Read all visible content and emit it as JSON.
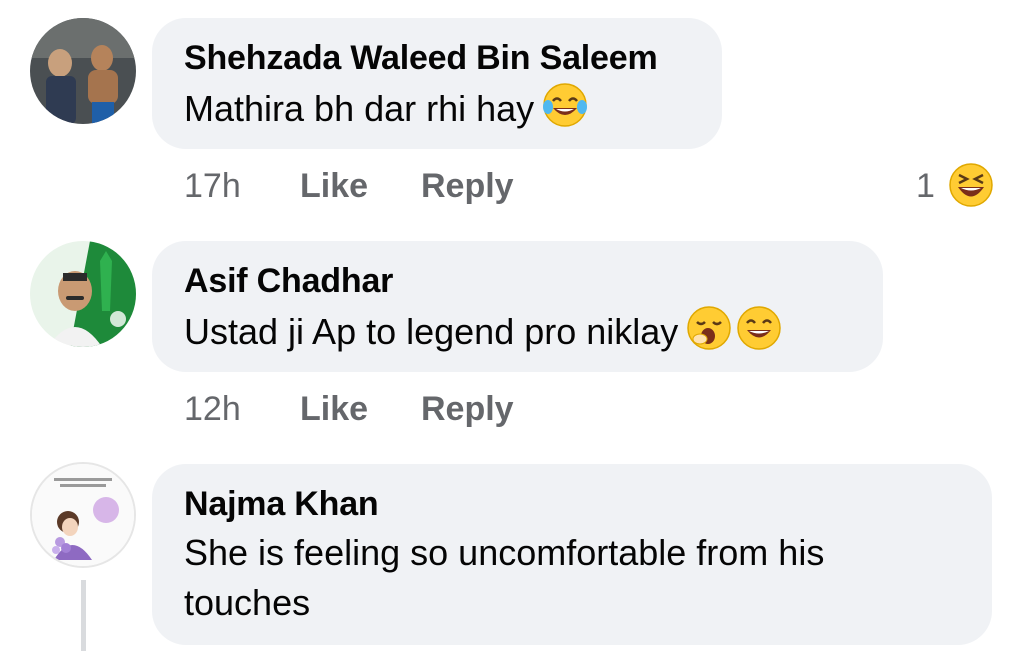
{
  "comments": [
    {
      "author": "Shehzada Waleed Bin Saleem",
      "text": "Mathira bh dar rhi hay",
      "emojis": [
        "tears-of-joy-emoji"
      ],
      "time": "17h",
      "like_label": "Like",
      "reply_label": "Reply",
      "reaction_count": "1",
      "reaction_icon": "laughing-squint-emoji"
    },
    {
      "author": "Asif Chadhar",
      "text": "Ustad ji Ap to legend pro niklay",
      "emojis": [
        "yawning-emoji",
        "grinning-squint-emoji"
      ],
      "time": "12h",
      "like_label": "Like",
      "reply_label": "Reply"
    },
    {
      "author": "Najma Khan",
      "text": "She is feeling so uncomfortable from his touches"
    }
  ],
  "colors": {
    "bubble_bg": "#f0f2f5",
    "meta_text": "#65676b",
    "primary_text": "#050505",
    "emoji_yellow": "#ffcc33"
  }
}
